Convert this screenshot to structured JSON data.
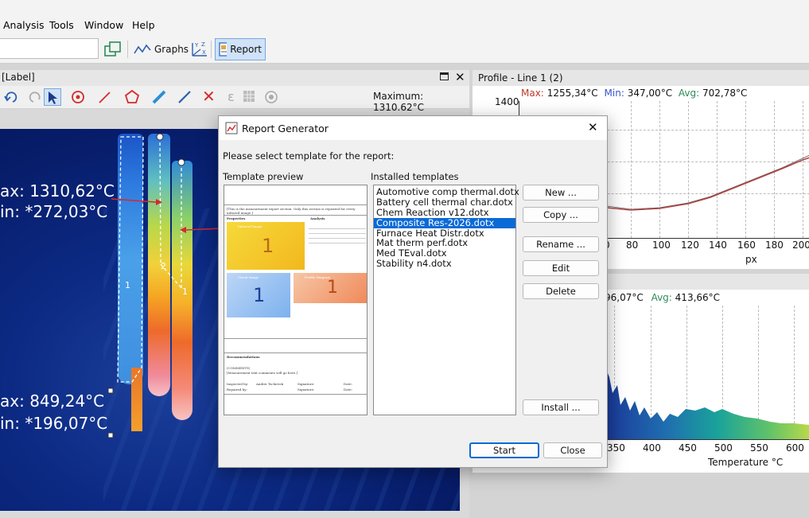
{
  "menu": [
    "Analysis",
    "Tools",
    "Window",
    "Help"
  ],
  "toolbar": {
    "graphs_label": "Graphs",
    "report_label": "Report",
    "axis_icon_text": "YZX"
  },
  "image_panel": {
    "title": "[Label]",
    "maximum_text": "Maximum: 1310.62°C",
    "labels": {
      "max1": "ax: 1310,62°C",
      "min1": "in: *272,03°C",
      "max2": "ax: 849,24°C",
      "min2": "in: *196,07°C",
      "roi_1": "1",
      "roi_2": "2",
      "roi_1b": "1"
    }
  },
  "profile_panel": {
    "title": "Profile - Line 1 (2)",
    "max_label": "Max:",
    "max_value": "1255,34°C",
    "min_label": "Min:",
    "min_value": "347,00°C",
    "avg_label": "Avg:",
    "avg_value": "702,78°C",
    "y_top": "1400",
    "x_ticks": [
      "80",
      "100",
      "120",
      "140",
      "160",
      "180",
      "200"
    ],
    "x_partial": "0",
    "xlabel": "px"
  },
  "histogram_panel": {
    "min_value_partial": "96,07°C",
    "avg_label": "Avg:",
    "avg_value": "413,66°C",
    "x_ticks": [
      "350",
      "400",
      "450",
      "500",
      "550",
      "600"
    ],
    "xlabel": "Temperature °C"
  },
  "dialog": {
    "title": "Report Generator",
    "prompt": "Please select template for the report:",
    "preview_label": "Template preview",
    "installed_label": "Installed templates",
    "templates": [
      "Automotive comp thermal.dotx",
      "Battery cell thermal char.dotx",
      "Chem Reaction v12.dotx",
      "Composite Res-2026.dotx",
      "Furnace Heat Distr.dotx",
      "Mat therm perf.dotx",
      "Med TEval.dotx",
      "Stability n4.dotx"
    ],
    "selected_index": 3,
    "buttons": {
      "new": "New ...",
      "copy": "Copy ...",
      "rename": "Rename ...",
      "edit": "Edit",
      "delete": "Delete",
      "install": "Install ...",
      "start": "Start",
      "close": "Close"
    },
    "preview": {
      "intro": "[This is the measurement report section. Only this section is repeated for every infrared image.]",
      "properties": "Properties",
      "analysis": "Analysis",
      "infrared_image": "Infrared Image",
      "visual_image": "Visual Image",
      "profile_diagram": "Profile Diagram",
      "num1": "1",
      "num2": "1",
      "num3": "1",
      "recommendations": "Recommendations",
      "comments": "(COMMENTS)",
      "comments_note": "[Measurement text comments will go here.]",
      "inspected_by": "Inspected by:",
      "repaired_by": "Repaired by:",
      "inspector": "Andrei Tschirvsk",
      "signature": "Signature:",
      "date": "Date:"
    }
  },
  "colors": {
    "accent": "#0a6ad6",
    "max_red": "#c0392b",
    "min_blue": "#3a55c8",
    "avg_green": "#2e8b57",
    "profile_line": "#b04545"
  }
}
